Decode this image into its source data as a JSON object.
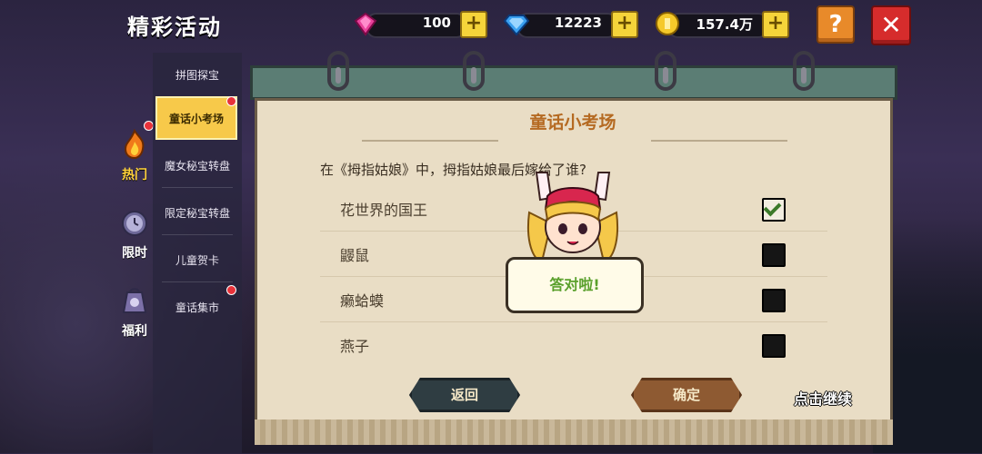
{
  "header": {
    "title": "精彩活动",
    "resources": [
      {
        "icon": "pink-gem-icon",
        "value": "100"
      },
      {
        "icon": "blue-diamond-icon",
        "value": "12223"
      },
      {
        "icon": "gold-coin-icon",
        "value": "157.4万"
      }
    ],
    "help_label": "?",
    "close_label": "✕"
  },
  "categories": [
    {
      "label": "热门",
      "icon": "flame-icon"
    },
    {
      "label": "限时",
      "icon": "clock-icon"
    },
    {
      "label": "福利",
      "icon": "gift-bag-icon"
    }
  ],
  "sidebar": {
    "items": [
      {
        "label": "拼图探宝"
      },
      {
        "label": "童话小考场"
      },
      {
        "label": "魔女秘宝转盘"
      },
      {
        "label": "限定秘宝转盘"
      },
      {
        "label": "儿童贺卡"
      },
      {
        "label": "童话集市"
      }
    ]
  },
  "quiz": {
    "title": "童话小考场",
    "question": "在《拇指姑娘》中，拇指姑娘最后嫁给了谁?",
    "options": [
      {
        "label": "花世界的国王",
        "checked": true
      },
      {
        "label": "鼹鼠",
        "checked": false
      },
      {
        "label": "癞蛤蟆",
        "checked": false
      },
      {
        "label": "燕子",
        "checked": false
      }
    ],
    "back_label": "返回",
    "confirm_label": "确定",
    "continue_label": "点击继续",
    "popup_text": "答对啦!"
  },
  "colors": {
    "accent_gold": "#f7c94a",
    "panel_bg": "#e9ddc5",
    "title_orange": "#b56a22",
    "correct_green": "#5aa02c",
    "close_red": "#d62c2c"
  }
}
